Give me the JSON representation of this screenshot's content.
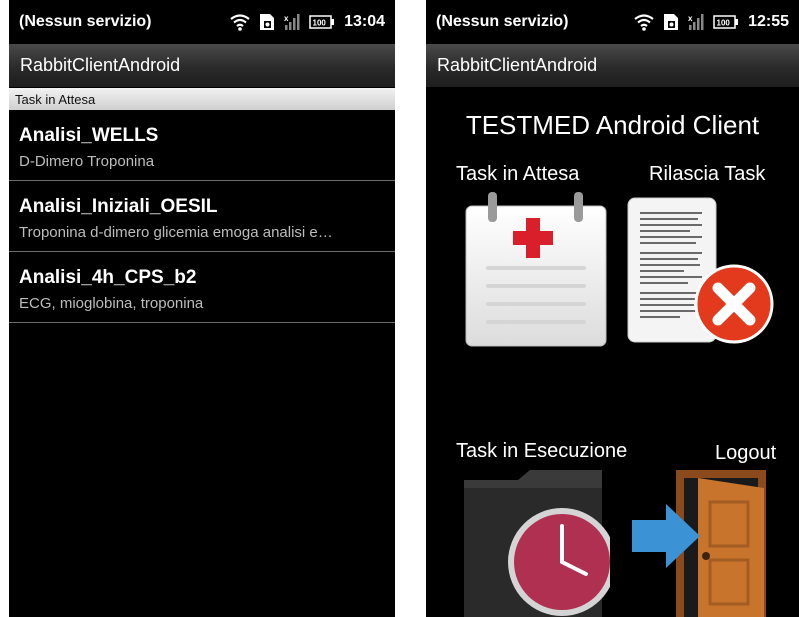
{
  "left": {
    "status_bar": {
      "carrier": "(Nessun servizio)",
      "time": "13:04",
      "battery": "100"
    },
    "app_title": "RabbitClientAndroid",
    "section_header": "Task in Attesa",
    "tasks": [
      {
        "name": "Analisi_WELLS",
        "description": "D-Dimero Troponina"
      },
      {
        "name": "Analisi_Iniziali_OESIL",
        "description": "Troponina d-dimero glicemia emoga analisi e…"
      },
      {
        "name": "Analisi_4h_CPS_b2",
        "description": "ECG, mioglobina, troponina"
      }
    ]
  },
  "right": {
    "status_bar": {
      "carrier": "(Nessun servizio)",
      "time": "12:55",
      "battery": "100"
    },
    "app_title": "RabbitClientAndroid",
    "dashboard_title": "TESTMED Android Client",
    "tiles": {
      "pending": {
        "label": "Task in Attesa",
        "icon": "calendar-medical-icon"
      },
      "release": {
        "label": "Rilascia Task",
        "icon": "document-delete-icon"
      },
      "running": {
        "label": "Task in Esecuzione",
        "icon": "folder-clock-icon"
      },
      "logout": {
        "label": "Logout",
        "icon": "door-exit-icon"
      }
    }
  },
  "colors": {
    "background": "#000000",
    "header_bar": "#2a2a2a",
    "red_cross": "#d91f2a",
    "delete_badge": "#e33a1e",
    "door": "#c9742c",
    "arrow": "#3b93d6"
  }
}
